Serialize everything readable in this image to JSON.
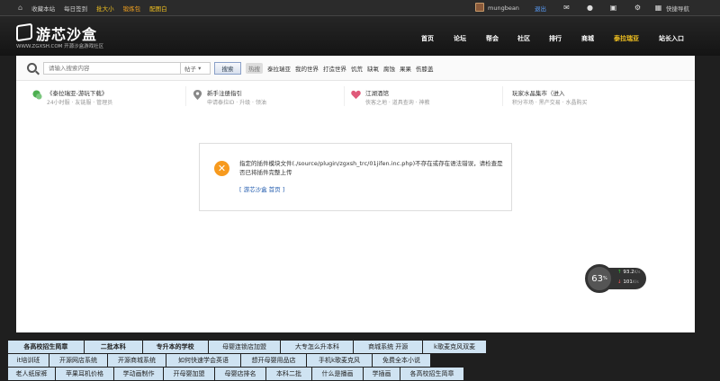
{
  "topbar": {
    "left": [
      "收藏本站",
      "每日签到",
      "批大小",
      "锻炼包",
      "配图白"
    ],
    "username": "mungbean",
    "logout": "退出",
    "quicknav": "快捷导航"
  },
  "header": {
    "logo_text": "游芯沙盒",
    "logo_sub": "WWW.ZGXSH.COM  开源沙盒游戏社区",
    "nav": [
      "首页",
      "论坛",
      "帮会",
      "社区",
      "排行",
      "商城",
      "泰拉瑞亚",
      "站长入口"
    ],
    "active_nav": "泰拉瑞亚"
  },
  "search": {
    "placeholder": "请输入搜索内容",
    "scope": "帖子",
    "button": "搜索",
    "hot_label": "热搜",
    "hot_items": [
      "泰拉瑞亚",
      "我的世界",
      "打造世界",
      "饥荒",
      "缺氧",
      "腐蚀",
      "果果",
      "伤膝盖"
    ]
  },
  "quick": [
    {
      "title": "《泰拉瑞亚-游玩下载》",
      "sub": "24小时服 · 友链服 · 管理员",
      "icon_color": "#4caf50"
    },
    {
      "title": "新手注册指引",
      "sub": "申请泰拉ID · 升级 · 领油",
      "icon_color": "#888888"
    },
    {
      "title": "江湖酒馆",
      "sub": "侠客之地 · 道具查询 · 神教",
      "icon_color": "#e05a7a"
    },
    {
      "title": "玩家水晶集市（进入",
      "sub": "积分市场 · 黑产交易 · 水晶购买",
      "icon_color": "#aaaaaa"
    }
  ],
  "error": {
    "message": "指定的插件模块文件(./source/plugin/zgxsh_trc/01jifen.inc.php)不存在或存在语法错误，请检查是否已将插件完整上传",
    "link": "[ 游芯沙盒 首页 ]"
  },
  "speed": {
    "percent": "63",
    "unit": "%",
    "up": "93.2",
    "up_unit": "K/s",
    "down": "101",
    "down_unit": "K/s"
  },
  "ads": [
    [
      "各高校招生简章",
      "二批本科",
      "专升本的学校",
      "母婴连锁店加盟",
      "大专怎么升本科",
      "商城系统 开源",
      "k歌麦克风双麦"
    ],
    [
      "it培训班",
      "开源网店系统",
      "开源商城系统",
      "如何快速学会英语",
      "想开母婴用品店",
      "手机k歌麦克风",
      "免费全本小说"
    ],
    [
      "老人纸尿裤",
      "苹果耳机价格",
      "学动画制作",
      "开母婴加盟",
      "母婴店排名",
      "本科二批",
      "什么是播画",
      "学插画",
      "各高校招生简章"
    ]
  ]
}
